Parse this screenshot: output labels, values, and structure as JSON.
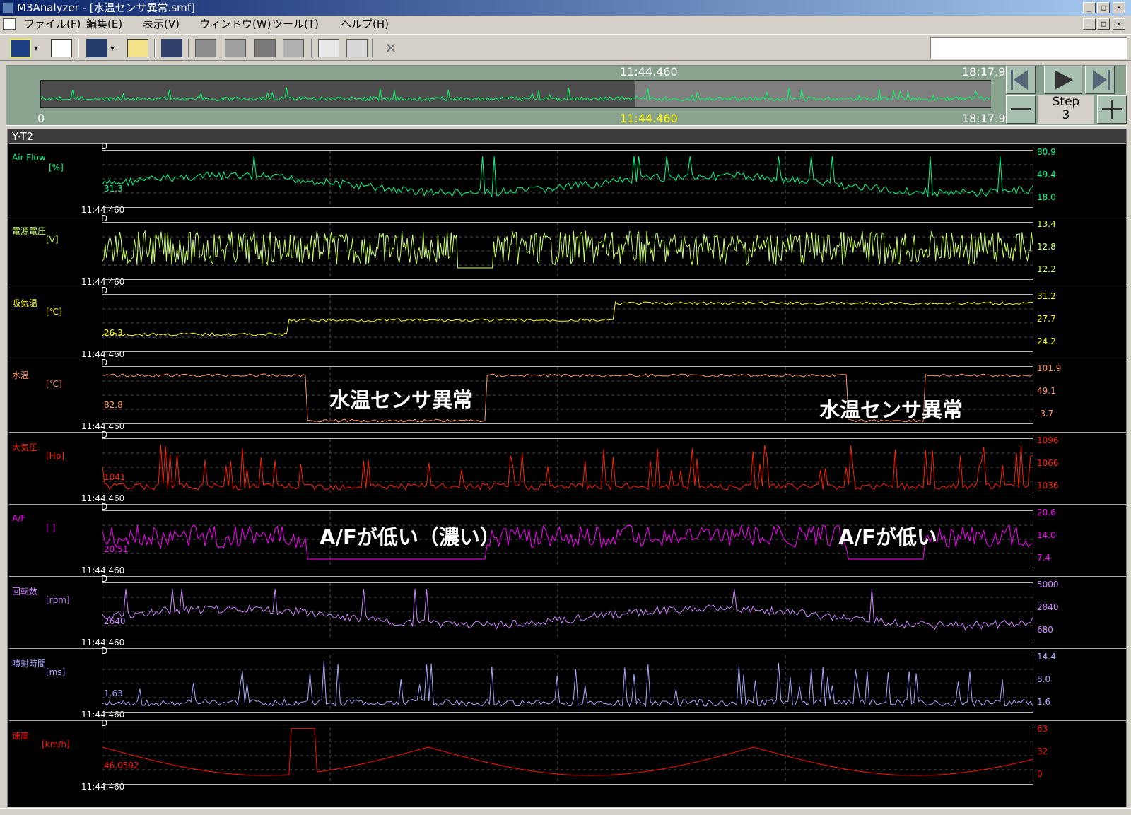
{
  "window": {
    "title": "M3Analyzer - [水温センサ異常.smf]",
    "buttons": [
      "_",
      "□",
      "×"
    ]
  },
  "menu": [
    "ファイル(F)",
    "編集(E)",
    "表示(V)",
    "ウィンドウ(W)",
    "ツール(T)",
    "ヘルプ(H)"
  ],
  "toolbar_icons": [
    "graph-icon",
    "waveform-icon",
    "data-transfer-icon",
    "measure-icon",
    "monitor-icon",
    "gray-box-icon",
    "triangle-box-icon",
    "dark-box-icon",
    "text-icon",
    "preview-icon",
    "print-icon",
    "pin-icon"
  ],
  "overview": {
    "top_left_time": "11:44.460",
    "top_right_time": "18:17.910",
    "bottom_left_time": "0",
    "bottom_center_time": "11:44.460",
    "bottom_right_time": "18:17.910",
    "selection_start_fraction": 0.626,
    "step_label": "Step",
    "step_value": "3"
  },
  "yt": {
    "title": "Y-T2"
  },
  "channels": [
    {
      "name": "Air Flow",
      "unit": "[%]",
      "color": "#00ff88",
      "time": "11:44.460",
      "cursor": "31.3",
      "ticks": [
        "80.9",
        "49.4",
        "18.0"
      ],
      "marker": "D"
    },
    {
      "name": "電源電圧",
      "unit": "[V]",
      "color": "#ccff66",
      "time": "11:44.460",
      "cursor": "",
      "ticks": [
        "13.4",
        "12.8",
        "12.2"
      ],
      "marker": "D"
    },
    {
      "name": "吸気温",
      "unit": "[℃]",
      "color": "#ffff00",
      "time": "11:44.460",
      "cursor": "26.3",
      "ticks": [
        "31.2",
        "27.7",
        "24.2"
      ],
      "marker": "D"
    },
    {
      "name": "水温",
      "unit": "[℃]",
      "color": "#ff9966",
      "time": "11:44.460",
      "cursor": "82.8",
      "ticks": [
        "101.9",
        "49.1",
        "-3.7"
      ],
      "marker": "D"
    },
    {
      "name": "大気圧",
      "unit": "[Hp]",
      "color": "#ff2200",
      "time": "11:44.460",
      "cursor": "1041",
      "ticks": [
        "1096",
        "1066",
        "1036"
      ],
      "marker": "D"
    },
    {
      "name": "A/F",
      "unit": "[ ]",
      "color": "#ff00ff",
      "time": "11:44.460",
      "cursor": "20.51",
      "ticks": [
        "20.6",
        "14.0",
        "7.4"
      ],
      "marker": "D"
    },
    {
      "name": "回転数",
      "unit": "[rpm]",
      "color": "#cc88ff",
      "time": "11:44.460",
      "cursor": "2640",
      "ticks": [
        "5000",
        "2840",
        "680"
      ],
      "marker": "D"
    },
    {
      "name": "噴射時間",
      "unit": "[ms]",
      "color": "#aaaaff",
      "time": "11:44.460",
      "cursor": "1.63",
      "ticks": [
        "14.4",
        "8.0",
        "1.6"
      ],
      "marker": "D"
    },
    {
      "name": "速度",
      "unit": "[km/h]",
      "color": "#ff1100",
      "time": "11:44.460",
      "cursor": "46.0592",
      "ticks": [
        "63",
        "32",
        "0"
      ],
      "marker": "D"
    }
  ],
  "annotations": [
    "水温センサ異常",
    "水温センサ異常",
    "A/Fが低い（濃い）",
    "A/Fが低い"
  ]
}
